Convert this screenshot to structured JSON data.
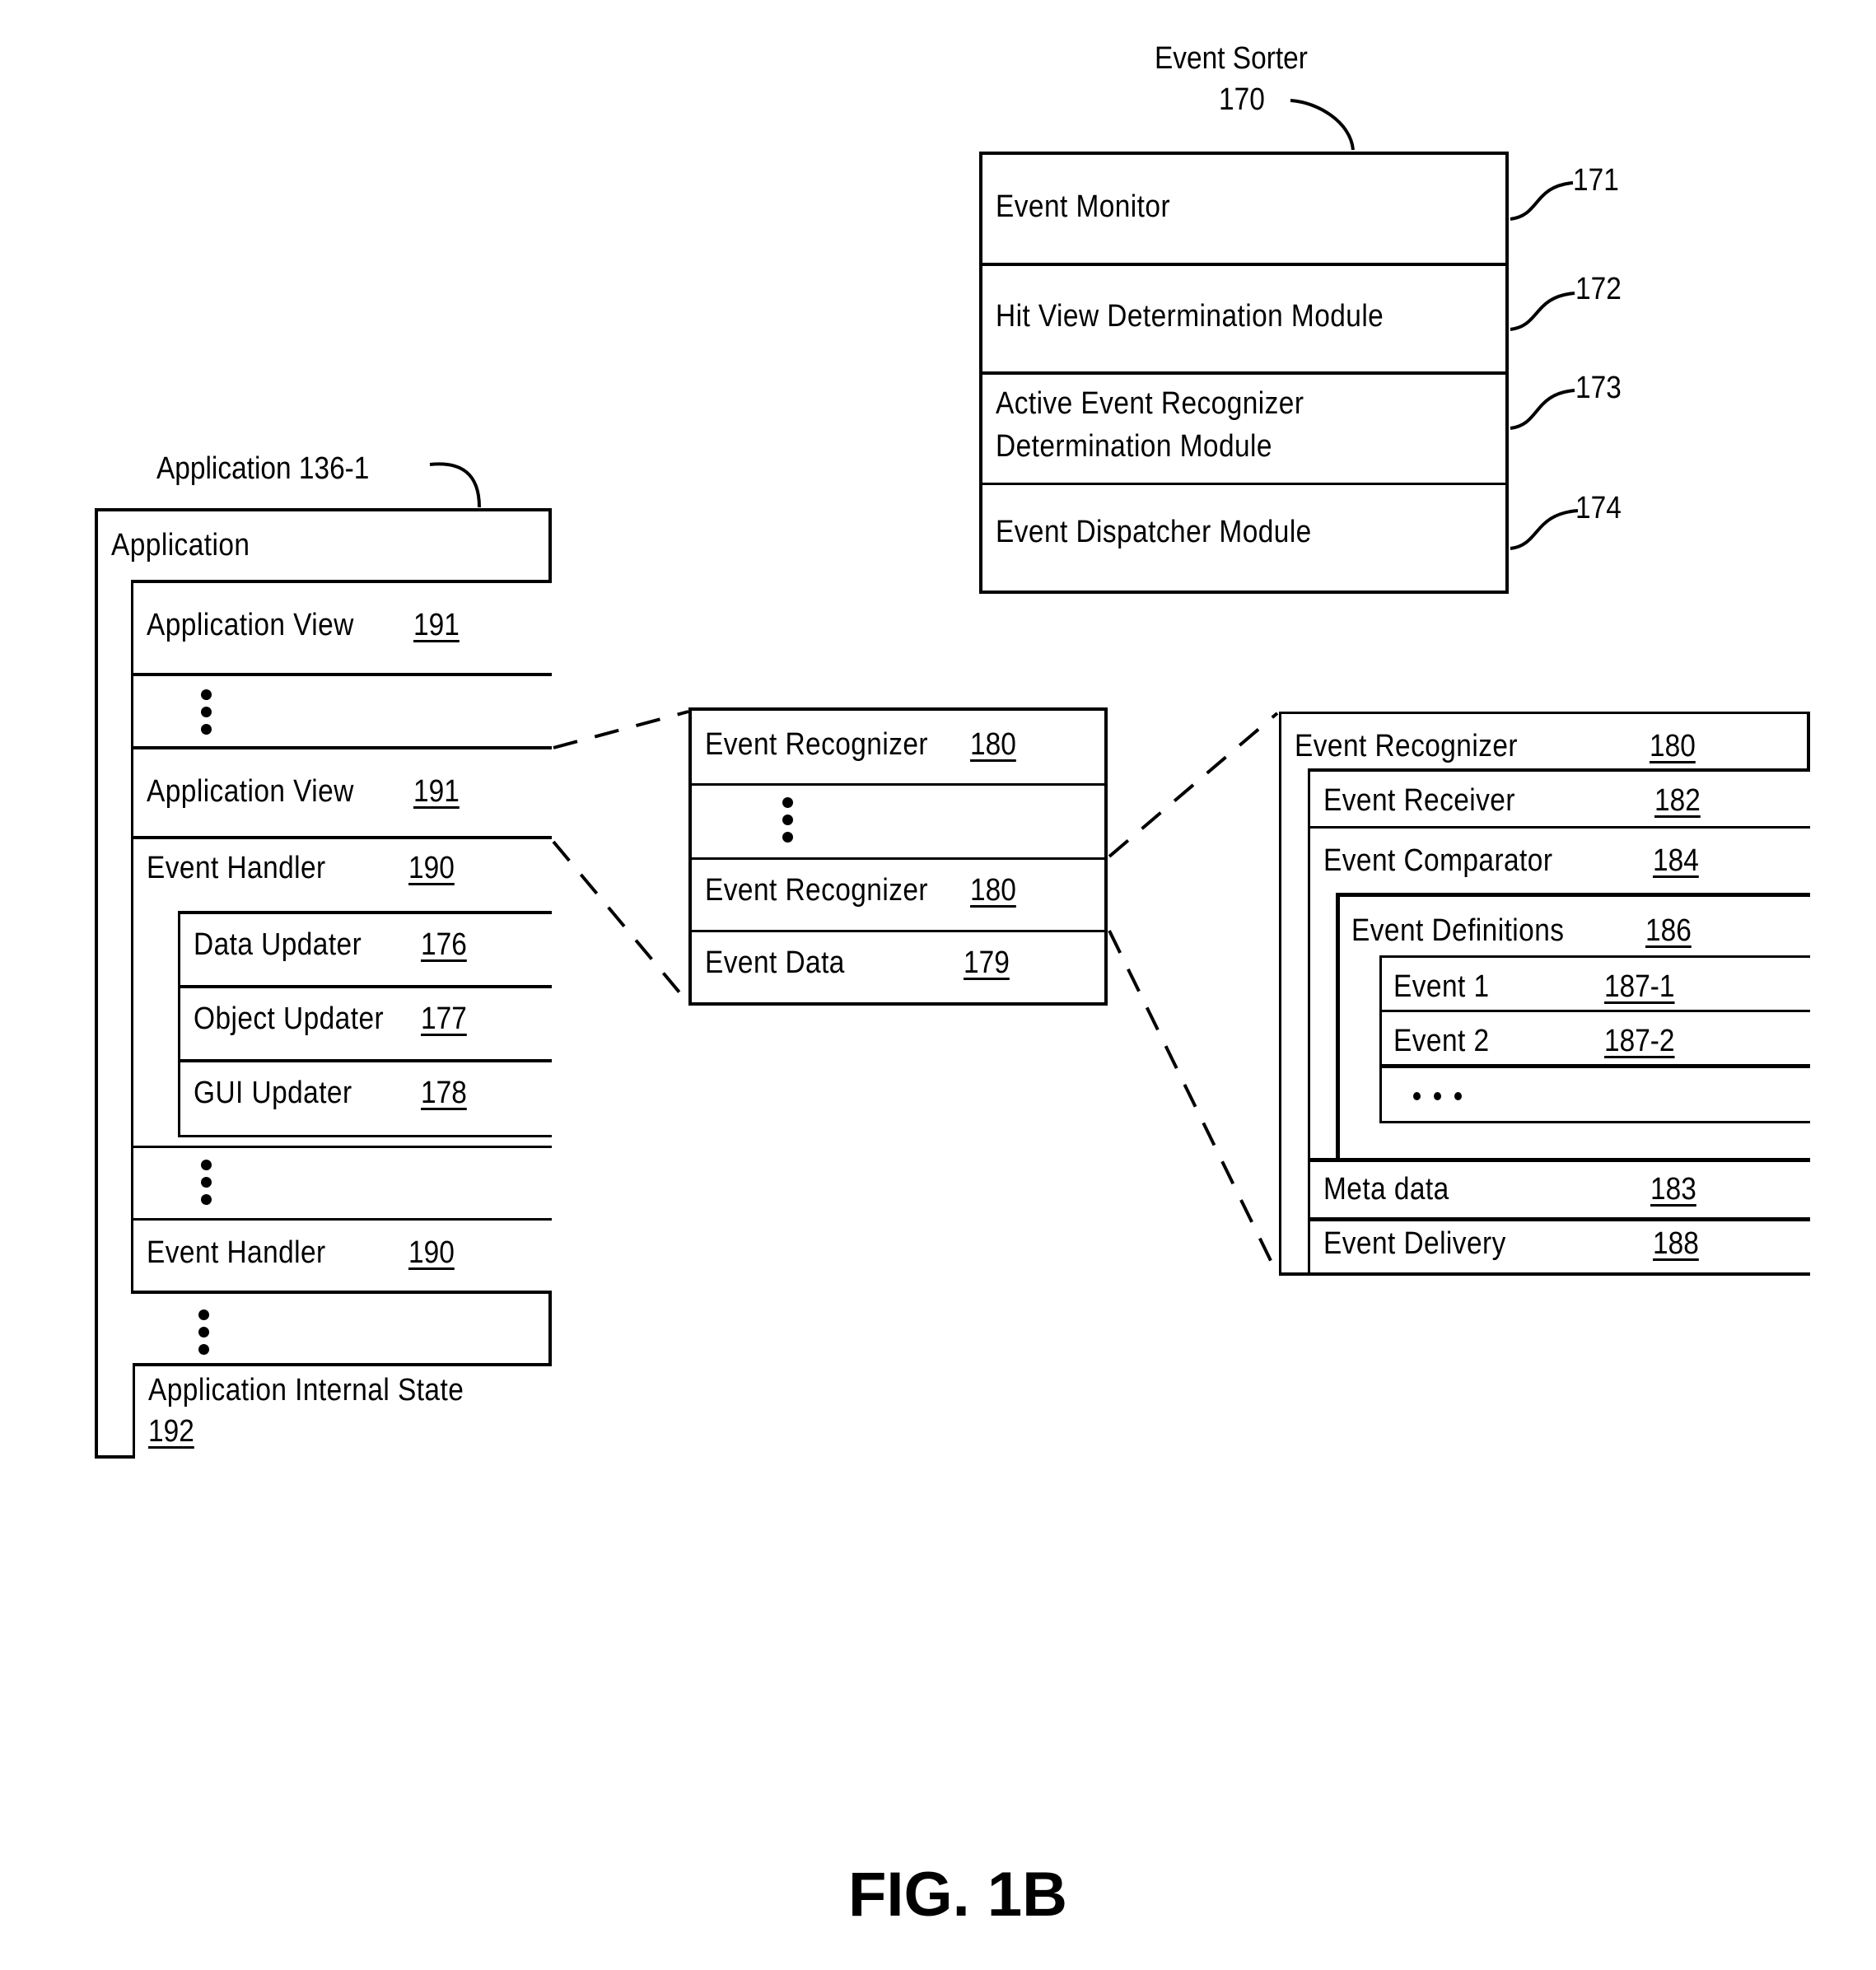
{
  "figure_label": "FIG. 1B",
  "event_sorter": {
    "title": "Event Sorter",
    "ref": "170",
    "modules": [
      {
        "label": "Event Monitor",
        "ref": "171"
      },
      {
        "label": "Hit View Determination Module",
        "ref": "172"
      },
      {
        "label_line1": "Active Event Recognizer",
        "label_line2": "Determination Module",
        "ref": "173"
      },
      {
        "label": "Event Dispatcher Module",
        "ref": "174"
      }
    ]
  },
  "application": {
    "callout": "Application 136-1",
    "header": "Application",
    "views": [
      {
        "label": "Application View",
        "ref": "191"
      },
      {
        "label": "Application View",
        "ref": "191"
      }
    ],
    "event_handlers": [
      {
        "label": "Event Handler",
        "ref": "190",
        "updaters": [
          {
            "label": "Data Updater",
            "ref": "176"
          },
          {
            "label": "Object Updater",
            "ref": "177"
          },
          {
            "label": "GUI Updater",
            "ref": "178"
          }
        ]
      },
      {
        "label": "Event Handler",
        "ref": "190"
      }
    ],
    "internal_state": {
      "label": "Application Internal State",
      "ref": "192"
    }
  },
  "recognizer_list": {
    "items": [
      {
        "label": "Event Recognizer",
        "ref": "180"
      },
      {
        "label": "Event Recognizer",
        "ref": "180"
      }
    ],
    "event_data": {
      "label": "Event Data",
      "ref": "179"
    }
  },
  "recognizer_detail": {
    "title": {
      "label": "Event Recognizer",
      "ref": "180"
    },
    "receiver": {
      "label": "Event Receiver",
      "ref": "182"
    },
    "comparator": {
      "label": "Event Comparator",
      "ref": "184"
    },
    "definitions": {
      "label": "Event Definitions",
      "ref": "186"
    },
    "events": [
      {
        "label": "Event 1",
        "ref": "187-1"
      },
      {
        "label": "Event 2",
        "ref": "187-2"
      }
    ],
    "metadata": {
      "label": "Meta data",
      "ref": "183"
    },
    "delivery": {
      "label": "Event Delivery",
      "ref": "188"
    }
  }
}
